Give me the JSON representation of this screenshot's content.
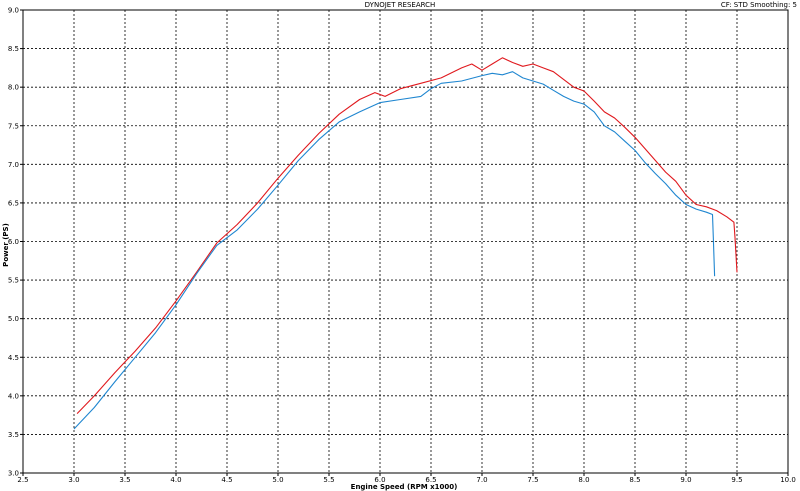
{
  "header": {
    "title": "DYNOJET RESEARCH",
    "settings": "CF: STD  Smoothing: 5"
  },
  "chart_data": {
    "type": "line",
    "title": "DYNOJET RESEARCH",
    "xlabel": "Engine Speed (RPM x1000)",
    "ylabel": "Power (PS)",
    "xlim": [
      2.5,
      10.0
    ],
    "ylim": [
      3.0,
      9.0
    ],
    "x_ticks": [
      "2.5",
      "3.0",
      "3.5",
      "4.0",
      "4.5",
      "5.0",
      "5.5",
      "6.0",
      "6.5",
      "7.0",
      "7.5",
      "8.0",
      "8.5",
      "9.0",
      "9.5",
      "10.0"
    ],
    "y_ticks": [
      "3.0",
      "3.5",
      "4.0",
      "4.5",
      "5.0",
      "5.5",
      "6.0",
      "6.5",
      "7.0",
      "7.5",
      "8.0",
      "8.5",
      "9.0"
    ],
    "grid": true,
    "series": [
      {
        "color": "#e0191e",
        "x": [
          3.03,
          3.2,
          3.4,
          3.6,
          3.8,
          4.0,
          4.2,
          4.4,
          4.6,
          4.8,
          5.0,
          5.2,
          5.4,
          5.6,
          5.8,
          5.95,
          6.05,
          6.2,
          6.4,
          6.6,
          6.8,
          6.9,
          7.0,
          7.1,
          7.2,
          7.3,
          7.4,
          7.5,
          7.6,
          7.7,
          7.8,
          7.9,
          8.0,
          8.1,
          8.2,
          8.3,
          8.4,
          8.5,
          8.6,
          8.7,
          8.8,
          8.9,
          9.0,
          9.1,
          9.2,
          9.3,
          9.4,
          9.47,
          9.48,
          9.5
        ],
        "y": [
          3.77,
          4.0,
          4.3,
          4.58,
          4.88,
          5.23,
          5.6,
          5.98,
          6.22,
          6.5,
          6.82,
          7.12,
          7.4,
          7.65,
          7.84,
          7.93,
          7.88,
          7.98,
          8.05,
          8.12,
          8.25,
          8.3,
          8.22,
          8.3,
          8.38,
          8.32,
          8.27,
          8.3,
          8.25,
          8.2,
          8.1,
          8.0,
          7.95,
          7.82,
          7.68,
          7.6,
          7.48,
          7.35,
          7.2,
          7.05,
          6.9,
          6.78,
          6.6,
          6.48,
          6.45,
          6.4,
          6.32,
          6.25,
          6.05,
          5.6
        ]
      },
      {
        "color": "#1f86d0",
        "x": [
          3.0,
          3.2,
          3.4,
          3.6,
          3.8,
          4.0,
          4.2,
          4.4,
          4.6,
          4.8,
          5.0,
          5.2,
          5.4,
          5.6,
          5.8,
          6.0,
          6.2,
          6.4,
          6.5,
          6.6,
          6.8,
          7.0,
          7.1,
          7.2,
          7.3,
          7.4,
          7.5,
          7.6,
          7.7,
          7.8,
          7.9,
          8.0,
          8.1,
          8.2,
          8.3,
          8.4,
          8.5,
          8.6,
          8.7,
          8.8,
          8.9,
          9.0,
          9.1,
          9.2,
          9.26,
          9.27,
          9.28
        ],
        "y": [
          3.57,
          3.85,
          4.18,
          4.5,
          4.82,
          5.18,
          5.58,
          5.95,
          6.15,
          6.42,
          6.73,
          7.05,
          7.32,
          7.55,
          7.68,
          7.8,
          7.84,
          7.88,
          7.98,
          8.05,
          8.08,
          8.15,
          8.18,
          8.16,
          8.2,
          8.12,
          8.08,
          8.04,
          7.96,
          7.88,
          7.82,
          7.78,
          7.68,
          7.5,
          7.42,
          7.3,
          7.18,
          7.02,
          6.88,
          6.75,
          6.6,
          6.48,
          6.42,
          6.38,
          6.35,
          5.98,
          5.55
        ]
      }
    ]
  }
}
